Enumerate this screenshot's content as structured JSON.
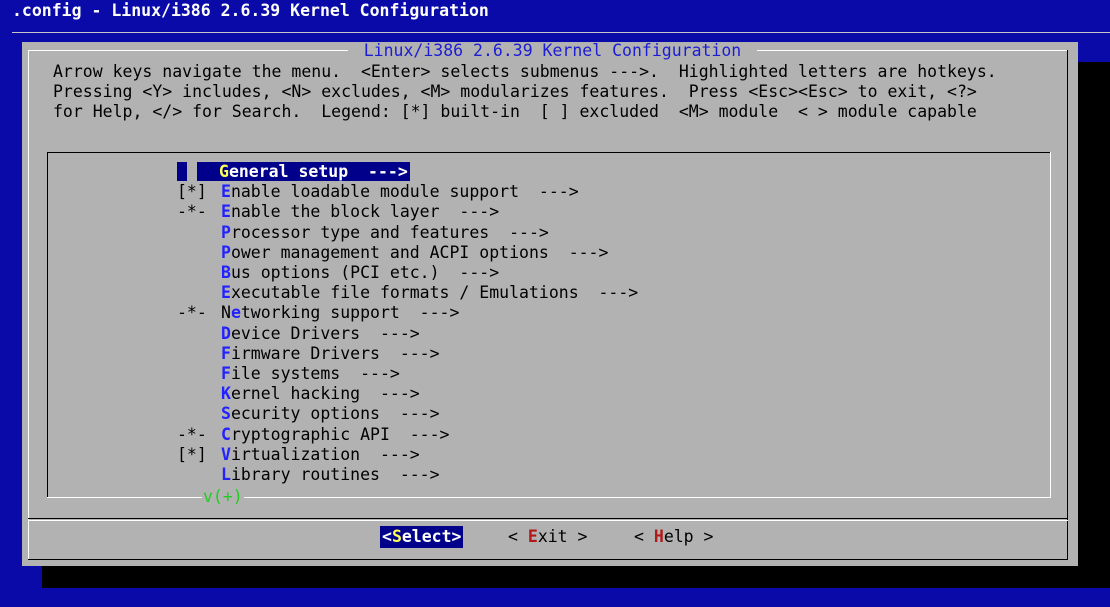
{
  "window": {
    "title": ".config - Linux/i386 2.6.39 Kernel Configuration"
  },
  "dialog": {
    "title": "Linux/i386 2.6.39 Kernel Configuration",
    "help_lines": [
      "Arrow keys navigate the menu.  <Enter> selects submenus --->.  Highlighted letters are hotkeys.",
      "Pressing <Y> includes, <N> excludes, <M> modularizes features.  Press <Esc><Esc> to exit, <?>",
      "for Help, </> for Search.  Legend: [*] built-in  [ ] excluded  <M> module  < > module capable"
    ]
  },
  "menu": {
    "selected_index": 0,
    "items": [
      {
        "prefix": "",
        "hotkey": "G",
        "rest": "eneral setup  --->"
      },
      {
        "prefix": "[*]",
        "hotkey": "E",
        "rest": "nable loadable module support  --->"
      },
      {
        "prefix": "-*-",
        "hotkey": "E",
        "rest": "nable the block layer  --->"
      },
      {
        "prefix": "",
        "hotkey": "P",
        "rest": "rocessor type and features  --->"
      },
      {
        "prefix": "",
        "hotkey": "P",
        "rest": "ower management and ACPI options  --->"
      },
      {
        "prefix": "",
        "hotkey": "B",
        "rest": "us options (PCI etc.)  --->"
      },
      {
        "prefix": "",
        "hotkey": "E",
        "rest": "xecutable file formats / Emulations  --->"
      },
      {
        "prefix": "-*-",
        "pre": "N",
        "hotkey": "e",
        "rest": "tworking support  --->"
      },
      {
        "prefix": "",
        "hotkey": "D",
        "rest": "evice Drivers  --->"
      },
      {
        "prefix": "",
        "hotkey": "F",
        "rest": "irmware Drivers  --->"
      },
      {
        "prefix": "",
        "hotkey": "F",
        "rest": "ile systems  --->"
      },
      {
        "prefix": "",
        "hotkey": "K",
        "rest": "ernel hacking  --->"
      },
      {
        "prefix": "",
        "hotkey": "S",
        "rest": "ecurity options  --->"
      },
      {
        "prefix": "-*-",
        "hotkey": "C",
        "rest": "ryptographic API  --->"
      },
      {
        "prefix": "[*]",
        "hotkey": "V",
        "rest": "irtualization  --->"
      },
      {
        "prefix": "",
        "hotkey": "L",
        "rest": "ibrary routines  --->"
      }
    ],
    "more_indicator": "v(+)"
  },
  "buttons": {
    "select": {
      "open": "<",
      "hotkey": "S",
      "rest": "elect>"
    },
    "exit": {
      "open": "< ",
      "hotkey": "E",
      "rest": "xit >"
    },
    "help": {
      "open": "< ",
      "hotkey": "H",
      "rest": "elp >"
    }
  },
  "colors": {
    "screen_bg": "#0a0aa8",
    "dialog_bg": "#b2b2b2",
    "selection_bg": "#00008a",
    "hotkey": "#2222ff",
    "selected_hotkey": "#ffff55",
    "button_hotkey": "#b21818",
    "more_indicator": "#22cc22"
  }
}
